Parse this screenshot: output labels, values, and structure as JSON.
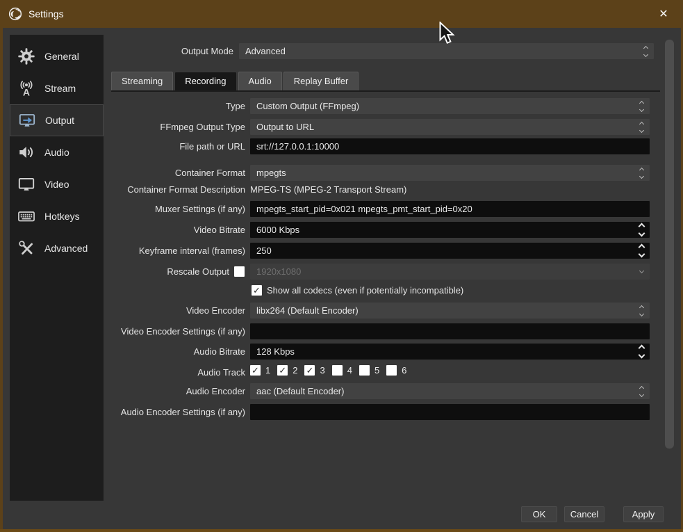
{
  "window": {
    "title": "Settings",
    "close_glyph": "✕"
  },
  "colors": {
    "titlebar": "#5c4119",
    "frame": "#6b4a16",
    "dialog_bg": "#373737",
    "sidebar_bg": "#1d1d1d",
    "selected_item_bg": "#2d2d2d",
    "combo_bg": "#424242",
    "input_bg": "#0e0e0e",
    "accent_blue": "#5d96d0",
    "tab_active_bg": "#181818",
    "tab_bg": "#4a4a4a",
    "button_bg": "#404040",
    "scrollbar_thumb": "#4e4e4e",
    "disabled_text": "#6f6f6f"
  },
  "sidebar": {
    "items": [
      {
        "label": "General",
        "icon": "gear-icon",
        "selected": false
      },
      {
        "label": "Stream",
        "icon": "broadcast-icon",
        "selected": false
      },
      {
        "label": "Output",
        "icon": "output-monitor-icon",
        "selected": true
      },
      {
        "label": "Audio",
        "icon": "speaker-icon",
        "selected": false
      },
      {
        "label": "Video",
        "icon": "monitor-icon",
        "selected": false
      },
      {
        "label": "Hotkeys",
        "icon": "keyboard-icon",
        "selected": false
      },
      {
        "label": "Advanced",
        "icon": "tools-icon",
        "selected": false
      }
    ]
  },
  "output_mode": {
    "label": "Output Mode",
    "value": "Advanced"
  },
  "tabs": [
    {
      "label": "Streaming",
      "active": false
    },
    {
      "label": "Recording",
      "active": true
    },
    {
      "label": "Audio",
      "active": false
    },
    {
      "label": "Replay Buffer",
      "active": false
    }
  ],
  "form": {
    "type": {
      "label": "Type",
      "value": "Custom Output (FFmpeg)"
    },
    "ffmpeg_output_type": {
      "label": "FFmpeg Output Type",
      "value": "Output to URL"
    },
    "file_path": {
      "label": "File path or URL",
      "value": "srt://127.0.0.1:10000"
    },
    "container_format": {
      "label": "Container Format",
      "value": "mpegts"
    },
    "container_format_description": {
      "label": "Container Format Description",
      "value": "MPEG-TS (MPEG-2 Transport Stream)"
    },
    "muxer_settings": {
      "label": "Muxer Settings (if any)",
      "value": "mpegts_start_pid=0x021 mpegts_pmt_start_pid=0x20"
    },
    "video_bitrate": {
      "label": "Video Bitrate",
      "value": "6000 Kbps"
    },
    "keyframe_interval": {
      "label": "Keyframe interval (frames)",
      "value": "250"
    },
    "rescale_output": {
      "label": "Rescale Output",
      "checked": false,
      "value": "1920x1080",
      "disabled": true
    },
    "show_all_codecs": {
      "label": "Show all codecs (even if potentially incompatible)",
      "checked": true
    },
    "video_encoder": {
      "label": "Video Encoder",
      "value": "libx264 (Default Encoder)"
    },
    "video_encoder_settings": {
      "label": "Video Encoder Settings (if any)",
      "value": ""
    },
    "audio_bitrate": {
      "label": "Audio Bitrate",
      "value": "128 Kbps"
    },
    "audio_track": {
      "label": "Audio Track",
      "tracks": [
        {
          "label": "1",
          "checked": true
        },
        {
          "label": "2",
          "checked": true
        },
        {
          "label": "3",
          "checked": true
        },
        {
          "label": "4",
          "checked": false
        },
        {
          "label": "5",
          "checked": false
        },
        {
          "label": "6",
          "checked": false
        }
      ]
    },
    "audio_encoder": {
      "label": "Audio Encoder",
      "value": "aac (Default Encoder)"
    },
    "audio_encoder_settings": {
      "label": "Audio Encoder Settings (if any)",
      "value": ""
    }
  },
  "footer": {
    "ok": "OK",
    "cancel": "Cancel",
    "apply": "Apply"
  }
}
